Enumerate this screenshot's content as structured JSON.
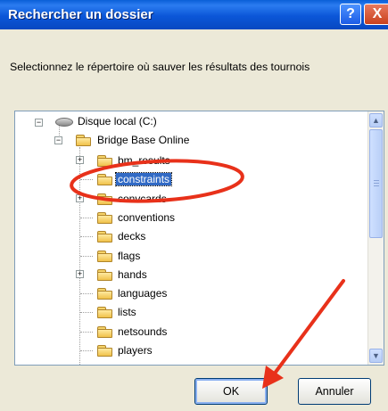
{
  "window": {
    "title": "Rechercher un dossier"
  },
  "title_buttons": {
    "help": "?",
    "close": "X"
  },
  "instruction": "Selectionnez le répertoire où sauver les résultats des tournois",
  "tree": {
    "root": "Disque local (C:)",
    "parent": "Bridge Base Online",
    "items": [
      {
        "label": "bm_results",
        "expander": "+"
      },
      {
        "label": "constraints",
        "expander": "",
        "selected": true
      },
      {
        "label": "convcards",
        "expander": "+"
      },
      {
        "label": "conventions",
        "expander": ""
      },
      {
        "label": "decks",
        "expander": ""
      },
      {
        "label": "flags",
        "expander": ""
      },
      {
        "label": "hands",
        "expander": "+"
      },
      {
        "label": "languages",
        "expander": ""
      },
      {
        "label": "lists",
        "expander": ""
      },
      {
        "label": "netsounds",
        "expander": ""
      },
      {
        "label": "players",
        "expander": ""
      }
    ]
  },
  "buttons": {
    "ok": "OK",
    "cancel": "Annuler"
  },
  "colors": {
    "annotation": "#e8311a",
    "selection": "#316ac5",
    "titlebar": "#0a5fd7"
  }
}
